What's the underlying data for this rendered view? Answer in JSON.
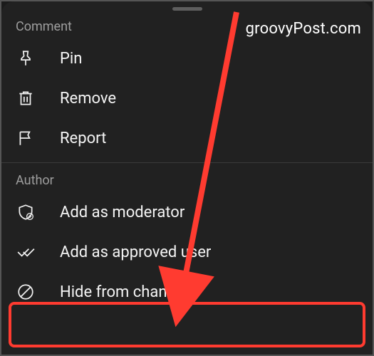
{
  "watermark": "groovyPost.com",
  "sections": {
    "comment": {
      "title": "Comment",
      "items": [
        {
          "name": "pin",
          "label": "Pin"
        },
        {
          "name": "remove",
          "label": "Remove"
        },
        {
          "name": "report",
          "label": "Report"
        }
      ]
    },
    "author": {
      "title": "Author",
      "items": [
        {
          "name": "add-moderator",
          "label": "Add as moderator"
        },
        {
          "name": "add-approved-user",
          "label": "Add as approved user"
        },
        {
          "name": "hide-from-channel",
          "label": "Hide from channel"
        }
      ]
    }
  },
  "annotation": {
    "highlight_target": "hide-from-channel",
    "arrow_color": "#ff3b30"
  }
}
